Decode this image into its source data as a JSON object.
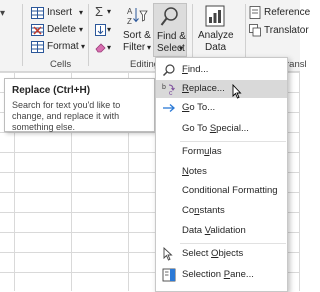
{
  "ribbon": {
    "cells_group": {
      "insert": "Insert",
      "delete": "Delete",
      "format": "Format",
      "label": "Cells"
    },
    "editing_group": {
      "sigma": "Σ",
      "sort_line1": "Sort &",
      "sort_line2": "Filter",
      "find_line1": "Find &",
      "find_line2": "Select",
      "label": "Editing"
    },
    "analyze": {
      "line1": "Analyze",
      "line2": "Data"
    },
    "reference": "Reference",
    "translator": "Translator",
    "partial_group_label": "ransl"
  },
  "tooltip": {
    "title": "Replace (Ctrl+H)",
    "description": "Search for text you'd like to change, and replace it with something else."
  },
  "menu": {
    "items": [
      {
        "label": "Find...",
        "underline": "F",
        "rest": "ind..."
      },
      {
        "label": "Replace...",
        "underline": "R",
        "rest": "eplace..."
      },
      {
        "label": "Go To...",
        "underline": "G",
        "rest": "o To..."
      },
      {
        "label": "Go To Special...",
        "pre": "Go To ",
        "underline": "S",
        "rest": "pecial..."
      },
      {
        "label": "Formulas",
        "pre": "Form",
        "underline": "u",
        "rest": "las"
      },
      {
        "label": "Notes",
        "underline": "N",
        "rest": "otes"
      },
      {
        "label": "Conditional Formatting",
        "pre": "Conditional Formatting",
        "underline": "",
        "rest": ""
      },
      {
        "label": "Constants",
        "pre": "Co",
        "underline": "n",
        "rest": "stants"
      },
      {
        "label": "Data Validation",
        "pre": "Data ",
        "underline": "V",
        "rest": "alidation"
      },
      {
        "label": "Select Objects",
        "pre": "Select ",
        "underline": "O",
        "rest": "bjects"
      },
      {
        "label": "Selection Pane...",
        "pre": "Selection ",
        "underline": "P",
        "rest": "ane..."
      }
    ],
    "highlighted": "Replace..."
  },
  "colors": {
    "ribbon_bg": "#f3f3f3",
    "button_pressed": "#dcdcdc",
    "menu_highlight": "#d9d9d9",
    "accent_blue": "#2b579a",
    "replace_purple": "#7c4d9c"
  }
}
